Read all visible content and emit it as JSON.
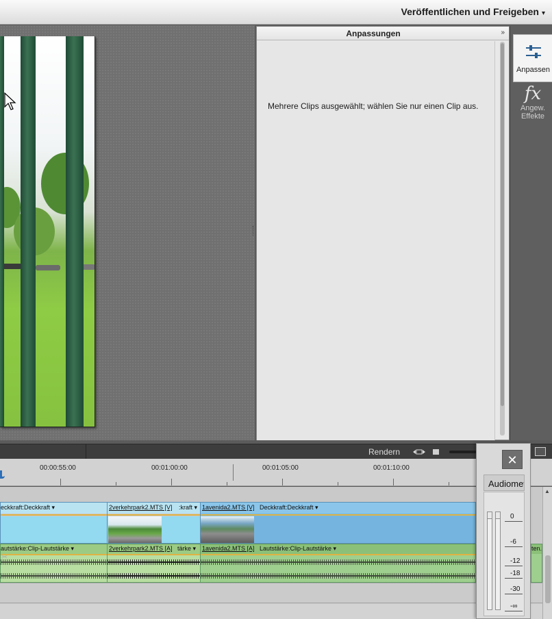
{
  "header": {
    "publish_label": "Veröffentlichen und Freigeben",
    "publish_caret": "▾"
  },
  "adjustments": {
    "title": "Anpassungen",
    "collapse_icon": "»",
    "message": "Mehrere Clips ausgewählt; wählen Sie nur einen Clip aus."
  },
  "toolstrip": {
    "items": [
      {
        "label": "Anpassen",
        "icon": "sliders-icon",
        "active": true
      },
      {
        "label": "Angew. Effekte",
        "icon": "fx-icon",
        "active": false,
        "glyph": "fx"
      }
    ]
  },
  "timeline": {
    "render_label": "Rendern",
    "timecodes": [
      "00:00:55:00",
      "00:01:00:00",
      "00:01:05:00",
      "00:01:10:00"
    ],
    "video_clips": [
      {
        "name": "",
        "fx": "eckkraft:Deckkraft ▾"
      },
      {
        "name": "2verkehrpark2.MTS [V]",
        "fx": ":kraft ▾"
      },
      {
        "name": "1avenida2.MTS [V]",
        "fx": "Deckkraft:Deckkraft ▾"
      }
    ],
    "audio_clips": [
      {
        "name": "",
        "fx": "autstärke:Clip-Lautstärke ▾"
      },
      {
        "name": "2verkehrpark2.MTS [A]",
        "fx": "tärke ▾"
      },
      {
        "name": "1avenida2.MTS [A]",
        "fx": "Lautstärke:Clip-Lautstärke ▾"
      }
    ],
    "audio_tail_label": "ten.I"
  },
  "audio_meter": {
    "close_label": "✕",
    "title": "Audiometer",
    "scale": [
      "0",
      "-6",
      "-12",
      "-18",
      "-30",
      "-∞"
    ]
  },
  "colors": {
    "accent_blue": "#2d6fb8",
    "video_clip": "#93d9ef",
    "audio_clip": "#b9dea2",
    "keyframe_line": "#e0b343"
  }
}
